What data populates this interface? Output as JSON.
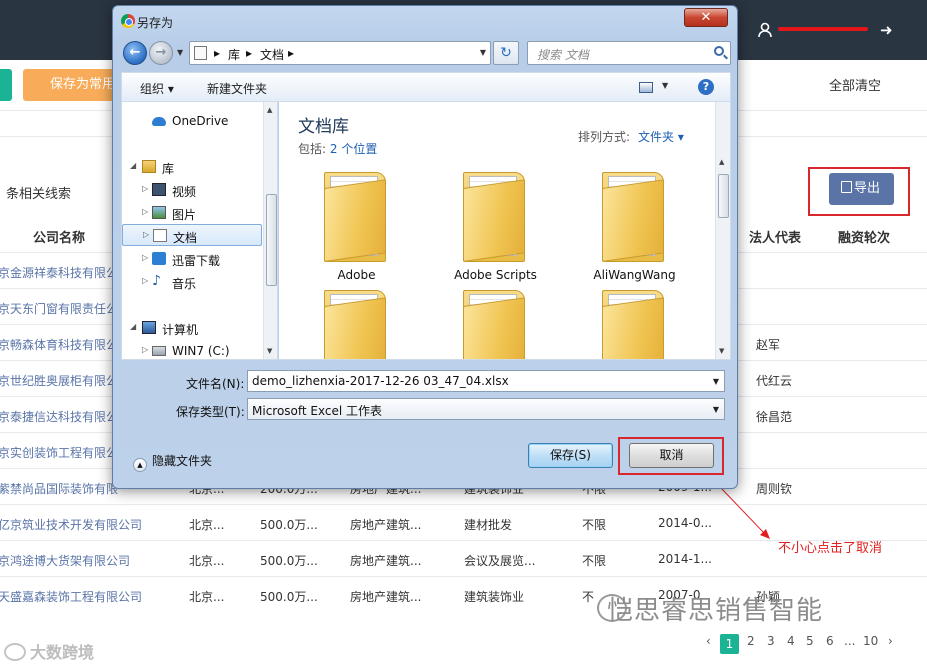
{
  "app": {
    "save_as_common_button": "保存为常用",
    "clear_all": "全部清空",
    "leads_label": "条相关线索",
    "export_button": "导出",
    "table": {
      "headers": {
        "company": "公司名称",
        "legal_rep": "法人代表",
        "funding_round": "融资轮次"
      },
      "rows": [
        {
          "company": "京金源祥泰科技有限公",
          "city": "",
          "capital": "",
          "industry": "",
          "scope": "",
          "limit": "",
          "date": "",
          "legal_rep": ""
        },
        {
          "company": "京天东门窗有限责任公",
          "city": "",
          "capital": "",
          "industry": "",
          "scope": "",
          "limit": "",
          "date": "",
          "legal_rep": ""
        },
        {
          "company": "京畅森体育科技有限公",
          "city": "",
          "capital": "",
          "industry": "",
          "scope": "",
          "limit": "",
          "date": "",
          "legal_rep": "赵军"
        },
        {
          "company": "京世纪胜奥展柜有限公",
          "city": "",
          "capital": "",
          "industry": "",
          "scope": "",
          "limit": "",
          "date": "",
          "legal_rep": "代红云"
        },
        {
          "company": "京泰捷信达科技有限公",
          "city": "",
          "capital": "",
          "industry": "",
          "scope": "",
          "limit": "",
          "date": "",
          "legal_rep": "徐昌范"
        },
        {
          "company": "京实创装饰工程有限公",
          "city": "",
          "capital": "",
          "industry": "",
          "scope": "",
          "limit": "",
          "date": "",
          "legal_rep": ""
        },
        {
          "company": "紫禁尚品国际装饰有限",
          "city": "北京...",
          "capital": "200.0万...",
          "industry": "房地产建筑...",
          "scope": "建筑装饰业",
          "limit": "不限",
          "date": "2009-1...",
          "legal_rep": "周则钦"
        },
        {
          "company": "亿京筑业技术开发有限公司",
          "city": "北京...",
          "capital": "500.0万...",
          "industry": "房地产建筑...",
          "scope": "建材批发",
          "limit": "不限",
          "date": "2014-0...",
          "legal_rep": ""
        },
        {
          "company": "京鸿途博大货架有限公司",
          "city": "北京...",
          "capital": "500.0万...",
          "industry": "房地产建筑...",
          "scope": "会议及展览...",
          "limit": "不限",
          "date": "2014-1...",
          "legal_rep": ""
        },
        {
          "company": "天盛嘉森装饰工程有限公司",
          "city": "北京...",
          "capital": "500.0万...",
          "industry": "房地产建筑...",
          "scope": "建筑装饰业",
          "limit": "不",
          "date": "2007-0",
          "legal_rep": "孙颖"
        }
      ]
    },
    "pagination": {
      "pages": [
        "1",
        "2",
        "3",
        "4",
        "5",
        "6",
        "...",
        "10"
      ],
      "current": "1",
      "prev": "‹",
      "next": "›"
    },
    "annotation": "不小心点击了取消",
    "watermark_right": "恺思睿思销售智能",
    "watermark_left": "大数跨境"
  },
  "dialog": {
    "title": "另存为",
    "close": "✕",
    "breadcrumb": [
      "库",
      "文档"
    ],
    "search_placeholder": "搜索 文档",
    "toolbar": {
      "organize": "组织 ▾",
      "new_folder": "新建文件夹"
    },
    "nav": [
      {
        "label": "OneDrive",
        "icon": "onedrive-icon"
      },
      {
        "label": "库",
        "icon": "library-icon"
      },
      {
        "label": "视频",
        "icon": "video-icon"
      },
      {
        "label": "图片",
        "icon": "pictures-icon"
      },
      {
        "label": "文档",
        "icon": "documents-icon"
      },
      {
        "label": "迅雷下载",
        "icon": "download-icon"
      },
      {
        "label": "音乐",
        "icon": "music-icon"
      },
      {
        "label": "计算机",
        "icon": "computer-icon"
      },
      {
        "label": "WIN7 (C:)",
        "icon": "drive-icon"
      }
    ],
    "library_title": "文档库",
    "includes_label": "包括:",
    "includes_link": "2 个位置",
    "arrange_label": "排列方式:",
    "arrange_value": "文件夹 ▾",
    "folders": [
      "Adobe",
      "Adobe Scripts",
      "AliWangWang",
      "",
      "",
      ""
    ],
    "filename_label": "文件名(N):",
    "filename_value": "demo_lizhenxia-2017-12-26 03_47_04.xlsx",
    "filetype_label": "保存类型(T):",
    "filetype_value": "Microsoft Excel 工作表",
    "hide_folders": "隐藏文件夹",
    "save_button": "保存(S)",
    "cancel_button": "取消"
  },
  "colors": {
    "topbar": "#2a3542",
    "accent_green": "#1ab394",
    "orange": "#f8ac59",
    "export_blue": "#5a74a8",
    "highlight_red": "#d9272e"
  }
}
